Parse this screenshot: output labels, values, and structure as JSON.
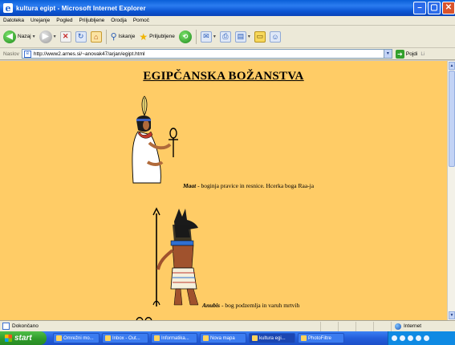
{
  "window": {
    "title": "kultura egipt - Microsoft Internet Explorer"
  },
  "menubar": {
    "items": [
      "Datoteka",
      "Urejanje",
      "Pogled",
      "Priljubljene",
      "Orodja",
      "Pomoč"
    ]
  },
  "toolbar": {
    "back_label": "Nazaj",
    "search_label": "Iskanje",
    "favorites_label": "Priljubljene"
  },
  "address": {
    "label": "Naslov",
    "url": "http://www2.arnes.si/~anovak47/arjan/egipt.html",
    "go_label": "Pojdi",
    "links_label": "Li"
  },
  "content": {
    "heading": "EGIPČANSKA BOŽANSTVA",
    "gods": [
      {
        "name": "Maat",
        "description": " - boginja pravice in resnice. Hcerka boga Raa-ja"
      },
      {
        "name": "Anubis",
        "description": " - bog podzemlja in varuh mrtvih"
      }
    ]
  },
  "statusbar": {
    "status_text": "Dokončano",
    "zone_text": "Internet"
  },
  "taskbar": {
    "start_label": "start",
    "tasks": [
      "Omrežni mo...",
      "Inbox - Out...",
      "Informatika...",
      "Nova mapa",
      "kultura egi...",
      "PhotoFiltre"
    ]
  }
}
